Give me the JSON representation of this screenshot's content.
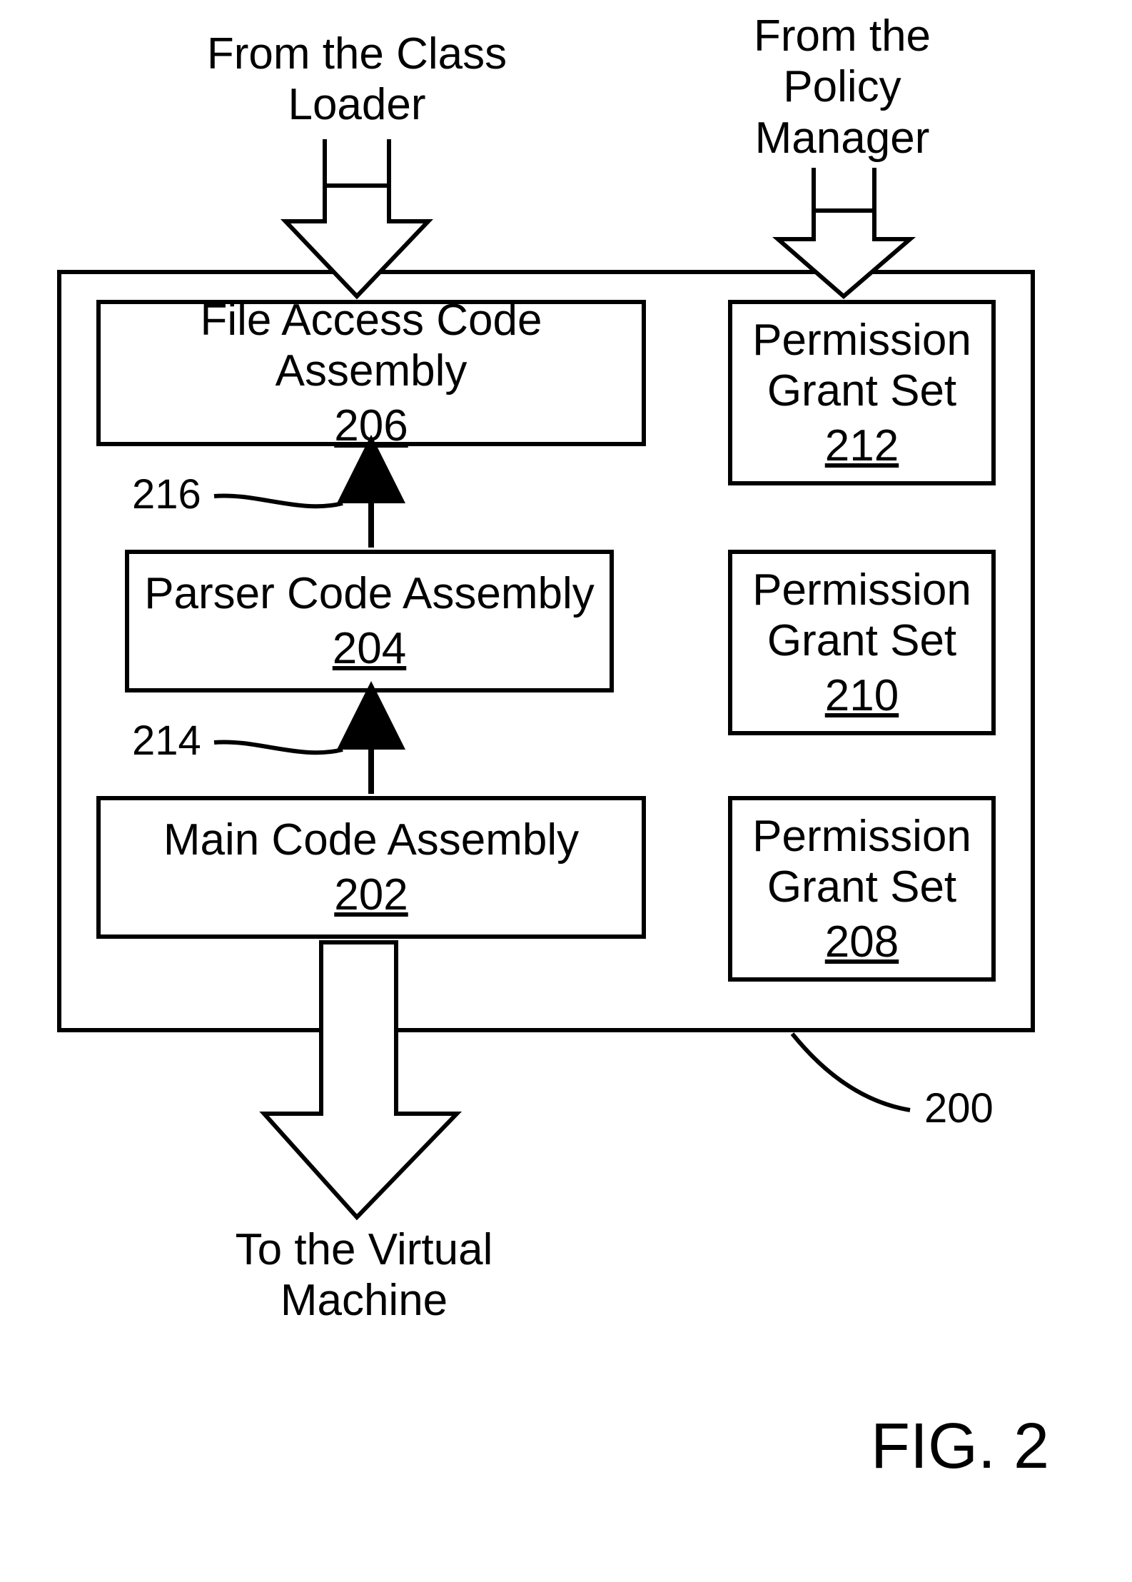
{
  "labels": {
    "top_left": "From the Class\nLoader",
    "top_right": "From the\nPolicy\nManager",
    "bottom": "To the Virtual\nMachine"
  },
  "boxes": {
    "file_access": {
      "title": "File Access Code Assembly",
      "num": "206"
    },
    "parser": {
      "title": "Parser Code Assembly",
      "num": "204"
    },
    "main": {
      "title": "Main Code Assembly",
      "num": "202"
    },
    "pgs_top": {
      "title": "Permission\nGrant Set",
      "num": "212"
    },
    "pgs_mid": {
      "title": "Permission\nGrant Set",
      "num": "210"
    },
    "pgs_bot": {
      "title": "Permission\nGrant Set",
      "num": "208"
    }
  },
  "refs": {
    "r216": "216",
    "r214": "214",
    "r200": "200"
  },
  "figure": "FIG. 2"
}
